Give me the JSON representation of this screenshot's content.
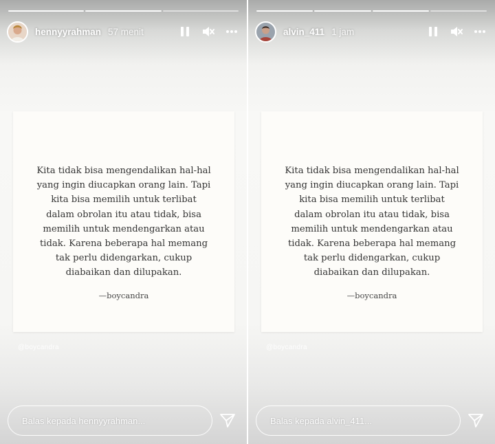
{
  "stories": [
    {
      "username": "hennyyrahman",
      "time": "57 menit",
      "quote_lines": [
        "Kita tidak bisa mengendalikan hal-hal",
        "yang ingin diucapkan orang lain. Tapi",
        "kita bisa memilih untuk terlibat",
        "dalam obrolan itu atau tidak, bisa",
        "memilih untuk mendengarkan atau",
        "tidak. Karena beberapa hal memang",
        "tak perlu didengarkan, cukup",
        "diabaikan dan dilupakan."
      ],
      "author": "—boycandra",
      "watermark": "@boycandra",
      "reply_placeholder": "Balas kepada hennyyrahman...",
      "progress_done": 2,
      "progress_total": 3
    },
    {
      "username": "alvin_411",
      "time": "1 jam",
      "quote_lines": [
        "Kita tidak bisa mengendalikan hal-hal",
        "yang ingin diucapkan orang lain. Tapi",
        "kita bisa memilih untuk terlibat",
        "dalam obrolan itu atau tidak, bisa",
        "memilih untuk mendengarkan atau",
        "tidak. Karena beberapa hal memang",
        "tak perlu didengarkan, cukup",
        "diabaikan dan dilupakan."
      ],
      "author": "—boycandra",
      "watermark": "@boycandra",
      "reply_placeholder": "Balas kepada alvin_411...",
      "progress_done": 3,
      "progress_total": 4
    }
  ],
  "icons": {
    "pause": "pause-icon",
    "mute": "mute-icon",
    "more": "more-icon",
    "send": "send-icon"
  },
  "colors": {
    "card": "#fdfcf9",
    "text": "#333333"
  }
}
